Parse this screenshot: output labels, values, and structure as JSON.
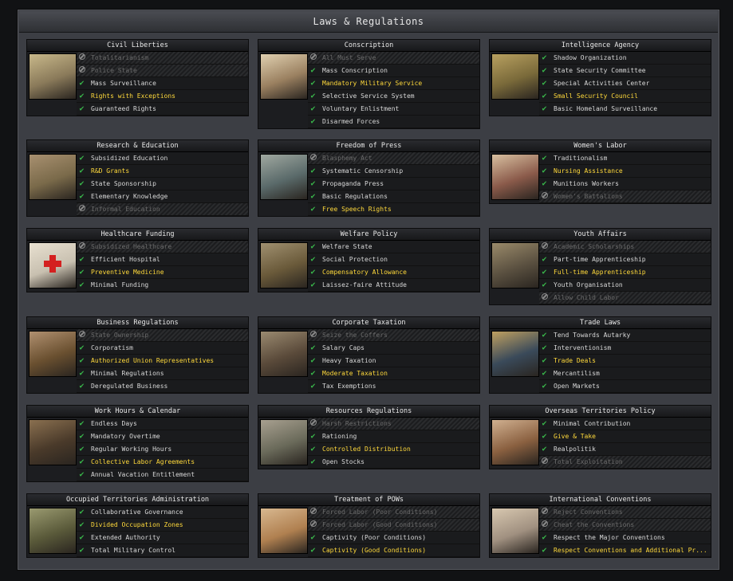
{
  "window": {
    "title": "Laws & Regulations"
  },
  "panels": [
    {
      "title": "Civil Liberties",
      "icon": "civil-liberties-illustration",
      "options": [
        {
          "label": "Totalitarianism",
          "state": "disabled"
        },
        {
          "label": "Police State",
          "state": "disabled"
        },
        {
          "label": "Mass Surveillance",
          "state": "available"
        },
        {
          "label": "Rights with Exceptions",
          "state": "selected"
        },
        {
          "label": "Guaranteed Rights",
          "state": "available"
        }
      ]
    },
    {
      "title": "Conscription",
      "icon": "conscription-illustration",
      "options": [
        {
          "label": "All Must Serve",
          "state": "disabled"
        },
        {
          "label": "Mass Conscription",
          "state": "available"
        },
        {
          "label": "Mandatory Military Service",
          "state": "selected"
        },
        {
          "label": "Selective Service System",
          "state": "available"
        },
        {
          "label": "Voluntary Enlistment",
          "state": "available"
        },
        {
          "label": "Disarmed Forces",
          "state": "available"
        }
      ]
    },
    {
      "title": "Intelligence Agency",
      "icon": "intelligence-agency-illustration",
      "options": [
        {
          "label": "Shadow Organization",
          "state": "available"
        },
        {
          "label": "State Security Committee",
          "state": "available"
        },
        {
          "label": "Special Activities Center",
          "state": "available"
        },
        {
          "label": "Small Security Council",
          "state": "selected"
        },
        {
          "label": "Basic Homeland Surveillance",
          "state": "available"
        }
      ]
    },
    {
      "title": "Research & Education",
      "icon": "research-education-illustration",
      "options": [
        {
          "label": "Subsidized Education",
          "state": "available"
        },
        {
          "label": "R&D Grants",
          "state": "selected"
        },
        {
          "label": "State Sponsorship",
          "state": "available"
        },
        {
          "label": "Elementary Knowledge",
          "state": "available"
        },
        {
          "label": "Informal Education",
          "state": "disabled"
        }
      ]
    },
    {
      "title": "Freedom of Press",
      "icon": "freedom-of-press-illustration",
      "options": [
        {
          "label": "Blasphemy Act",
          "state": "disabled"
        },
        {
          "label": "Systematic Censorship",
          "state": "available"
        },
        {
          "label": "Propaganda Press",
          "state": "available"
        },
        {
          "label": "Basic Regulations",
          "state": "available"
        },
        {
          "label": "Free Speech Rights",
          "state": "selected"
        }
      ]
    },
    {
      "title": "Women's Labor",
      "icon": "womens-labor-illustration",
      "options": [
        {
          "label": "Traditionalism",
          "state": "available"
        },
        {
          "label": "Nursing Assistance",
          "state": "selected"
        },
        {
          "label": "Munitions Workers",
          "state": "available"
        },
        {
          "label": "Women's Battalions",
          "state": "disabled"
        }
      ]
    },
    {
      "title": "Healthcare Funding",
      "icon": "healthcare-funding-illustration",
      "options": [
        {
          "label": "Subsidized Healthcare",
          "state": "disabled"
        },
        {
          "label": "Efficient Hospital",
          "state": "available"
        },
        {
          "label": "Preventive Medicine",
          "state": "selected"
        },
        {
          "label": "Minimal Funding",
          "state": "available"
        }
      ]
    },
    {
      "title": "Welfare Policy",
      "icon": "welfare-policy-illustration",
      "options": [
        {
          "label": "Welfare State",
          "state": "available"
        },
        {
          "label": "Social Protection",
          "state": "available"
        },
        {
          "label": "Compensatory Allowance",
          "state": "selected"
        },
        {
          "label": "Laissez-faire Attitude",
          "state": "available"
        }
      ]
    },
    {
      "title": "Youth Affairs",
      "icon": "youth-affairs-illustration",
      "options": [
        {
          "label": "Academic Scholarships",
          "state": "disabled"
        },
        {
          "label": "Part-time Apprenticeship",
          "state": "available"
        },
        {
          "label": "Full-time Apprenticeship",
          "state": "selected"
        },
        {
          "label": "Youth Organisation",
          "state": "available"
        },
        {
          "label": "Allow Child Labor",
          "state": "disabled"
        }
      ]
    },
    {
      "title": "Business Regulations",
      "icon": "business-regulations-illustration",
      "options": [
        {
          "label": "State Ownership",
          "state": "disabled"
        },
        {
          "label": "Corporatism",
          "state": "available"
        },
        {
          "label": "Authorized Union Representatives",
          "state": "selected"
        },
        {
          "label": "Minimal Regulations",
          "state": "available"
        },
        {
          "label": "Deregulated Business",
          "state": "available"
        }
      ]
    },
    {
      "title": "Corporate Taxation",
      "icon": "corporate-taxation-illustration",
      "options": [
        {
          "label": "Seize the Coffers",
          "state": "disabled"
        },
        {
          "label": "Salary Caps",
          "state": "available"
        },
        {
          "label": "Heavy Taxation",
          "state": "available"
        },
        {
          "label": "Moderate Taxation",
          "state": "selected"
        },
        {
          "label": "Tax Exemptions",
          "state": "available"
        }
      ]
    },
    {
      "title": "Trade Laws",
      "icon": "trade-laws-illustration",
      "options": [
        {
          "label": "Tend Towards Autarky",
          "state": "available"
        },
        {
          "label": "Interventionism",
          "state": "available"
        },
        {
          "label": "Trade Deals",
          "state": "selected"
        },
        {
          "label": "Mercantilism",
          "state": "available"
        },
        {
          "label": "Open Markets",
          "state": "available"
        }
      ]
    },
    {
      "title": "Work Hours & Calendar",
      "icon": "work-hours-illustration",
      "options": [
        {
          "label": "Endless Days",
          "state": "available"
        },
        {
          "label": "Mandatory Overtime",
          "state": "available"
        },
        {
          "label": "Regular Working Hours",
          "state": "available"
        },
        {
          "label": "Collective Labor Agreements",
          "state": "selected"
        },
        {
          "label": "Annual Vacation Entitlement",
          "state": "available"
        }
      ]
    },
    {
      "title": "Resources Regulations",
      "icon": "resources-regulations-illustration",
      "options": [
        {
          "label": "Harsh Restrictions",
          "state": "disabled"
        },
        {
          "label": "Rationing",
          "state": "available"
        },
        {
          "label": "Controlled Distribution",
          "state": "selected"
        },
        {
          "label": "Open Stocks",
          "state": "available"
        }
      ]
    },
    {
      "title": "Overseas Territories Policy",
      "icon": "overseas-territories-illustration",
      "options": [
        {
          "label": "Minimal Contribution",
          "state": "available"
        },
        {
          "label": "Give & Take",
          "state": "selected"
        },
        {
          "label": "Realpolitik",
          "state": "available"
        },
        {
          "label": "Total Exploitation",
          "state": "disabled"
        }
      ]
    },
    {
      "title": "Occupied Territories Administration",
      "icon": "occupied-territories-illustration",
      "options": [
        {
          "label": "Collaborative Governance",
          "state": "available"
        },
        {
          "label": "Divided Occupation Zones",
          "state": "selected"
        },
        {
          "label": "Extended Authority",
          "state": "available"
        },
        {
          "label": "Total Military Control",
          "state": "available"
        }
      ]
    },
    {
      "title": "Treatment of POWs",
      "icon": "treatment-of-pows-illustration",
      "options": [
        {
          "label": "Forced Labor (Poor Conditions)",
          "state": "disabled"
        },
        {
          "label": "Forced Labor (Good Conditions)",
          "state": "disabled"
        },
        {
          "label": "Captivity (Poor Conditions)",
          "state": "available"
        },
        {
          "label": "Captivity (Good Conditions)",
          "state": "selected"
        }
      ]
    },
    {
      "title": "International Conventions",
      "icon": "international-conventions-illustration",
      "options": [
        {
          "label": "Reject Conventions",
          "state": "disabled"
        },
        {
          "label": "Cheat the Conventions",
          "state": "disabled"
        },
        {
          "label": "Respect the Major Conventions",
          "state": "available"
        },
        {
          "label": "Respect Conventions and Additional Pr...",
          "state": "selected"
        }
      ]
    }
  ],
  "colors": {
    "selected_text": "#ffd93b",
    "check": "#39b54a",
    "disabled_text": "#6b6b6b"
  }
}
